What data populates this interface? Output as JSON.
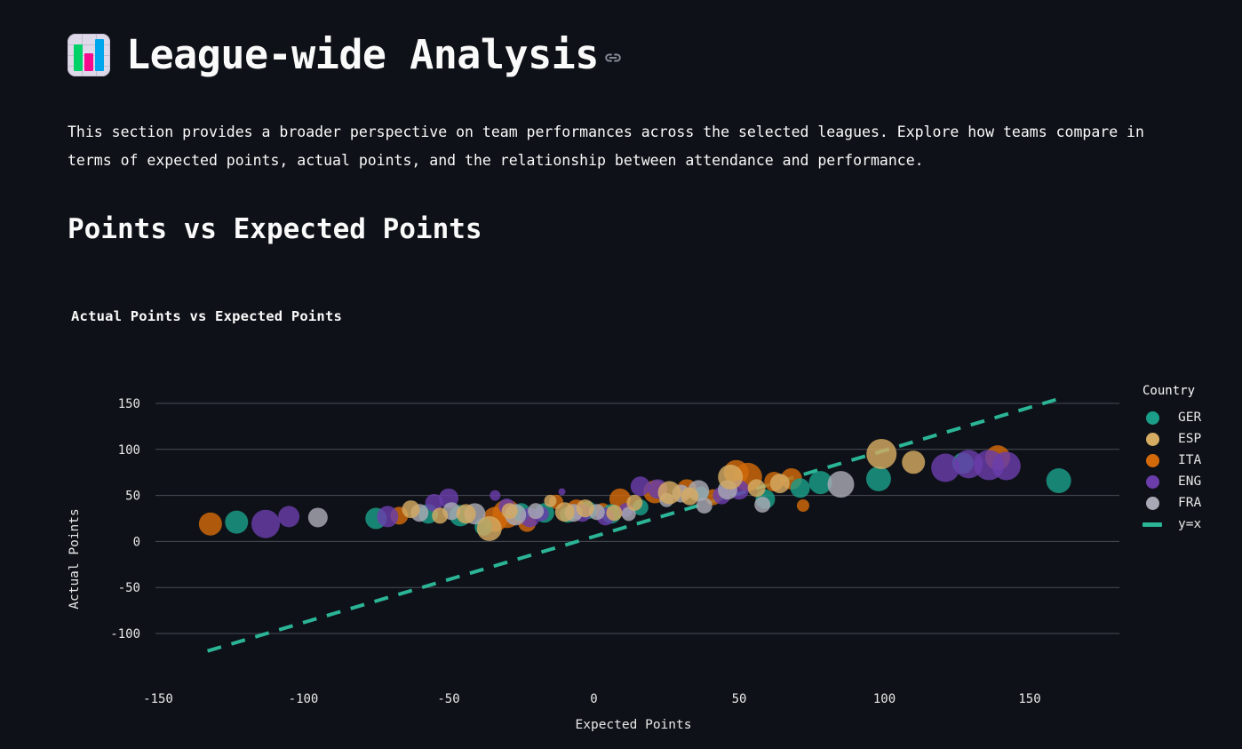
{
  "header": {
    "icon": "bar-chart-emoji",
    "title": "League-wide Analysis",
    "anchor_icon": "link-icon"
  },
  "intro": {
    "text": "This section provides a broader perspective on team performances across the selected leagues. Explore how teams compare in terms of expected points, actual points, and the relationship between attendance and performance."
  },
  "section": {
    "title": "Points vs Expected Points"
  },
  "colors": {
    "background": "#0e1117",
    "text": "#fafafa",
    "grid": "#7a7f8c",
    "tick": "#e8e8e8",
    "GER": "#1b9e89",
    "ESP": "#d6ab62",
    "ITA": "#d2690a",
    "ENG": "#6a3dab",
    "FRA": "#a9a9b5",
    "yx_line": "#2bb596"
  },
  "chart_data": {
    "type": "scatter",
    "title": "Actual Points vs Expected Points",
    "xlabel": "Expected Points",
    "ylabel": "Actual Points",
    "xlim": [
      -178,
      178
    ],
    "ylim": [
      -125,
      165
    ],
    "xticks": [
      -150,
      -100,
      -50,
      0,
      50,
      100,
      150
    ],
    "yticks": [
      -100,
      -50,
      0,
      50,
      100,
      150
    ],
    "grid": "horizontal",
    "legend": {
      "title": "Country",
      "position": "right",
      "entries": [
        {
          "label": "GER",
          "color": "#1b9e89",
          "marker": "circle"
        },
        {
          "label": "ESP",
          "color": "#d6ab62",
          "marker": "circle"
        },
        {
          "label": "ITA",
          "color": "#d2690a",
          "marker": "circle"
        },
        {
          "label": "ENG",
          "color": "#6a3dab",
          "marker": "circle"
        },
        {
          "label": "FRA",
          "color": "#a9a9b5",
          "marker": "circle"
        },
        {
          "label": "y=x",
          "color": "#2bb596",
          "marker": "dashed-line"
        }
      ]
    },
    "reference_line": {
      "label": "y=x",
      "x0": -133,
      "y0": -119,
      "x1": 159,
      "y1": 154,
      "style": "dashed"
    },
    "series": [
      {
        "name": "ITA",
        "color": "#d2690a",
        "points": [
          {
            "x": -132,
            "y": 19,
            "r": 13
          },
          {
            "x": -34,
            "y": 24,
            "r": 14
          },
          {
            "x": -30,
            "y": 30,
            "r": 16
          },
          {
            "x": -23,
            "y": 20,
            "r": 10
          },
          {
            "x": -13,
            "y": 43,
            "r": 8
          },
          {
            "x": -6,
            "y": 35,
            "r": 11
          },
          {
            "x": 3,
            "y": 33,
            "r": 9
          },
          {
            "x": 9,
            "y": 46,
            "r": 12
          },
          {
            "x": 21,
            "y": 54,
            "r": 13
          },
          {
            "x": 32,
            "y": 57,
            "r": 11
          },
          {
            "x": 41,
            "y": 48,
            "r": 9
          },
          {
            "x": 49,
            "y": 75,
            "r": 14
          },
          {
            "x": 53,
            "y": 70,
            "r": 16
          },
          {
            "x": 62,
            "y": 65,
            "r": 11
          },
          {
            "x": 68,
            "y": 68,
            "r": 12
          },
          {
            "x": 72,
            "y": 39,
            "r": 7
          },
          {
            "x": 139,
            "y": 91,
            "r": 14
          },
          {
            "x": -67,
            "y": 28,
            "r": 10
          }
        ]
      },
      {
        "name": "GER",
        "color": "#1b9e89",
        "points": [
          {
            "x": -123,
            "y": 21,
            "r": 13
          },
          {
            "x": -75,
            "y": 25,
            "r": 12
          },
          {
            "x": -57,
            "y": 30,
            "r": 11
          },
          {
            "x": -46,
            "y": 28,
            "r": 12
          },
          {
            "x": -38,
            "y": 16,
            "r": 10
          },
          {
            "x": -25,
            "y": 32,
            "r": 10
          },
          {
            "x": -17,
            "y": 31,
            "r": 11
          },
          {
            "x": -9,
            "y": 29,
            "r": 9
          },
          {
            "x": -2,
            "y": 34,
            "r": 10
          },
          {
            "x": 6,
            "y": 30,
            "r": 11
          },
          {
            "x": 16,
            "y": 37,
            "r": 9
          },
          {
            "x": 37,
            "y": 52,
            "r": 8
          },
          {
            "x": 59,
            "y": 46,
            "r": 11
          },
          {
            "x": 71,
            "y": 58,
            "r": 11
          },
          {
            "x": 78,
            "y": 64,
            "r": 13
          },
          {
            "x": 98,
            "y": 68,
            "r": 14
          },
          {
            "x": 127,
            "y": 85,
            "r": 12
          },
          {
            "x": 160,
            "y": 66,
            "r": 14
          }
        ]
      },
      {
        "name": "ENG",
        "color": "#6a3dab",
        "points": [
          {
            "x": -113,
            "y": 19,
            "r": 16
          },
          {
            "x": -105,
            "y": 27,
            "r": 12
          },
          {
            "x": -71,
            "y": 27,
            "r": 12
          },
          {
            "x": -55,
            "y": 42,
            "r": 10
          },
          {
            "x": -50,
            "y": 47,
            "r": 11
          },
          {
            "x": -34,
            "y": 50,
            "r": 6
          },
          {
            "x": -30,
            "y": 38,
            "r": 9
          },
          {
            "x": -22,
            "y": 26,
            "r": 11
          },
          {
            "x": -18,
            "y": 30,
            "r": 8
          },
          {
            "x": -11,
            "y": 54,
            "r": 4
          },
          {
            "x": -4,
            "y": 31,
            "r": 10
          },
          {
            "x": 4,
            "y": 27,
            "r": 10
          },
          {
            "x": 11,
            "y": 34,
            "r": 8
          },
          {
            "x": 16,
            "y": 60,
            "r": 11
          },
          {
            "x": 22,
            "y": 57,
            "r": 11
          },
          {
            "x": 44,
            "y": 50,
            "r": 10
          },
          {
            "x": 50,
            "y": 56,
            "r": 11
          },
          {
            "x": 121,
            "y": 80,
            "r": 16
          },
          {
            "x": 129,
            "y": 84,
            "r": 16
          },
          {
            "x": 136,
            "y": 83,
            "r": 17
          },
          {
            "x": 142,
            "y": 82,
            "r": 16
          }
        ]
      },
      {
        "name": "FRA",
        "color": "#a9a9b5",
        "points": [
          {
            "x": -95,
            "y": 26,
            "r": 11
          },
          {
            "x": -60,
            "y": 31,
            "r": 10
          },
          {
            "x": -49,
            "y": 33,
            "r": 10
          },
          {
            "x": -41,
            "y": 30,
            "r": 12
          },
          {
            "x": -27,
            "y": 29,
            "r": 12
          },
          {
            "x": -20,
            "y": 33,
            "r": 9
          },
          {
            "x": -7,
            "y": 31,
            "r": 10
          },
          {
            "x": 1,
            "y": 32,
            "r": 9
          },
          {
            "x": 12,
            "y": 30,
            "r": 8
          },
          {
            "x": 25,
            "y": 45,
            "r": 8
          },
          {
            "x": 30,
            "y": 52,
            "r": 10
          },
          {
            "x": 36,
            "y": 55,
            "r": 12
          },
          {
            "x": 38,
            "y": 39,
            "r": 9
          },
          {
            "x": 46,
            "y": 56,
            "r": 11
          },
          {
            "x": 58,
            "y": 40,
            "r": 9
          },
          {
            "x": 85,
            "y": 62,
            "r": 15
          }
        ]
      },
      {
        "name": "ESP",
        "color": "#d6ab62",
        "points": [
          {
            "x": -63,
            "y": 35,
            "r": 10
          },
          {
            "x": -53,
            "y": 28,
            "r": 9
          },
          {
            "x": -44,
            "y": 30,
            "r": 11
          },
          {
            "x": -36,
            "y": 14,
            "r": 14
          },
          {
            "x": -29,
            "y": 33,
            "r": 9
          },
          {
            "x": -15,
            "y": 44,
            "r": 7
          },
          {
            "x": -10,
            "y": 32,
            "r": 11
          },
          {
            "x": -3,
            "y": 36,
            "r": 10
          },
          {
            "x": 7,
            "y": 31,
            "r": 9
          },
          {
            "x": 14,
            "y": 42,
            "r": 9
          },
          {
            "x": 26,
            "y": 53,
            "r": 13
          },
          {
            "x": 33,
            "y": 49,
            "r": 10
          },
          {
            "x": 47,
            "y": 70,
            "r": 14
          },
          {
            "x": 56,
            "y": 58,
            "r": 10
          },
          {
            "x": 64,
            "y": 63,
            "r": 11
          },
          {
            "x": 99,
            "y": 95,
            "r": 17
          },
          {
            "x": 110,
            "y": 86,
            "r": 13
          }
        ]
      }
    ]
  }
}
